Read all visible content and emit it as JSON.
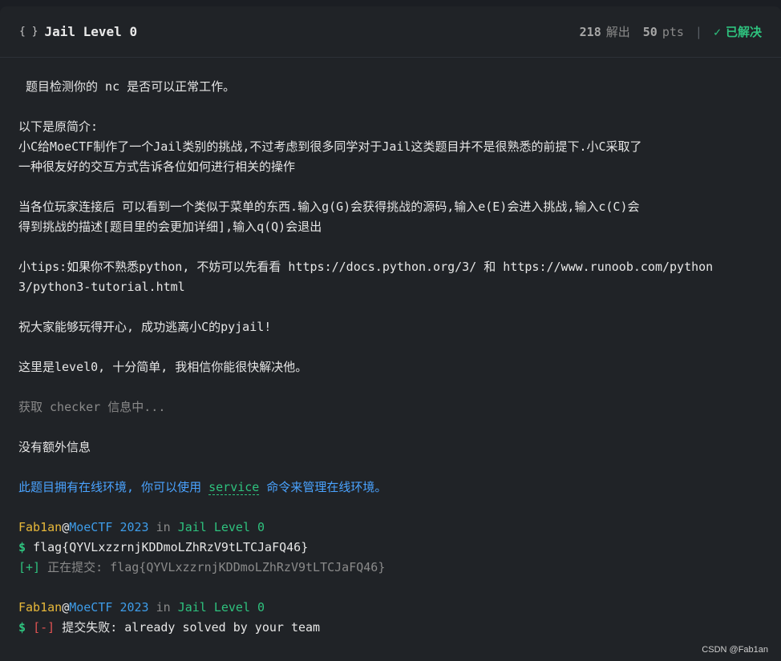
{
  "header": {
    "braces_icon": "braces-icon",
    "title": "Jail Level 0",
    "solves_count": "218",
    "solves_label": "解出",
    "points": "50",
    "points_label": "pts",
    "separator": "|",
    "check_icon": "✓",
    "status": "已解决"
  },
  "description": {
    "line1": " 题目检测你的 nc 是否可以正常工作。",
    "line2": "以下是原简介:",
    "line3": "小C给MoeCTF制作了一个Jail类别的挑战,不过考虑到很多同学对于Jail这类题目并不是很熟悉的前提下.小C采取了",
    "line4": "一种很友好的交互方式告诉各位如何进行相关的操作",
    "line5": "当各位玩家连接后 可以看到一个类似于菜单的东西.输入g(G)会获得挑战的源码,输入e(E)会进入挑战,输入c(C)会",
    "line6": "得到挑战的描述[题目里的会更加详细],输入q(Q)会退出",
    "line7": "小tips:如果你不熟悉python, 不妨可以先看看 https://docs.python.org/3/ 和 https://www.runoob.com/python",
    "line8": "3/python3-tutorial.html",
    "line9": "祝大家能够玩得开心, 成功逃离小C的pyjail!",
    "line10": "这里是level0, 十分简单, 我相信你能很快解决他。"
  },
  "checker": {
    "loading": "获取 checker 信息中...",
    "info": "没有额外信息"
  },
  "service_notice": {
    "before": "此题目拥有在线环境, 你可以使用 ",
    "command": "service",
    "after": " 命令来管理在线环境。"
  },
  "terminal": {
    "block1": {
      "user": "Fab1an",
      "at": "@",
      "org": "MoeCTF",
      "year": "2023",
      "in": "in",
      "challenge": "Jail Level 0",
      "prompt": "$",
      "command": "flag{QYVLxzzrnjKDDmoLZhRzV9tLTCJaFQ46}",
      "status_tag": "[+]",
      "status_text": "正在提交: flag{QYVLxzzrnjKDDmoLZhRzV9tLTCJaFQ46}"
    },
    "block2": {
      "user": "Fab1an",
      "at": "@",
      "org": "MoeCTF",
      "year": "2023",
      "in": "in",
      "challenge": "Jail Level 0",
      "prompt": "$",
      "status_tag": "[-]",
      "status_text": "提交失败: already solved by your team"
    }
  },
  "watermark": "CSDN @Fab1an",
  "colors": {
    "background": "#202327",
    "success": "#2ec27e",
    "error": "#e05252",
    "user": "#e7b83a",
    "link": "#4aa3ff"
  }
}
